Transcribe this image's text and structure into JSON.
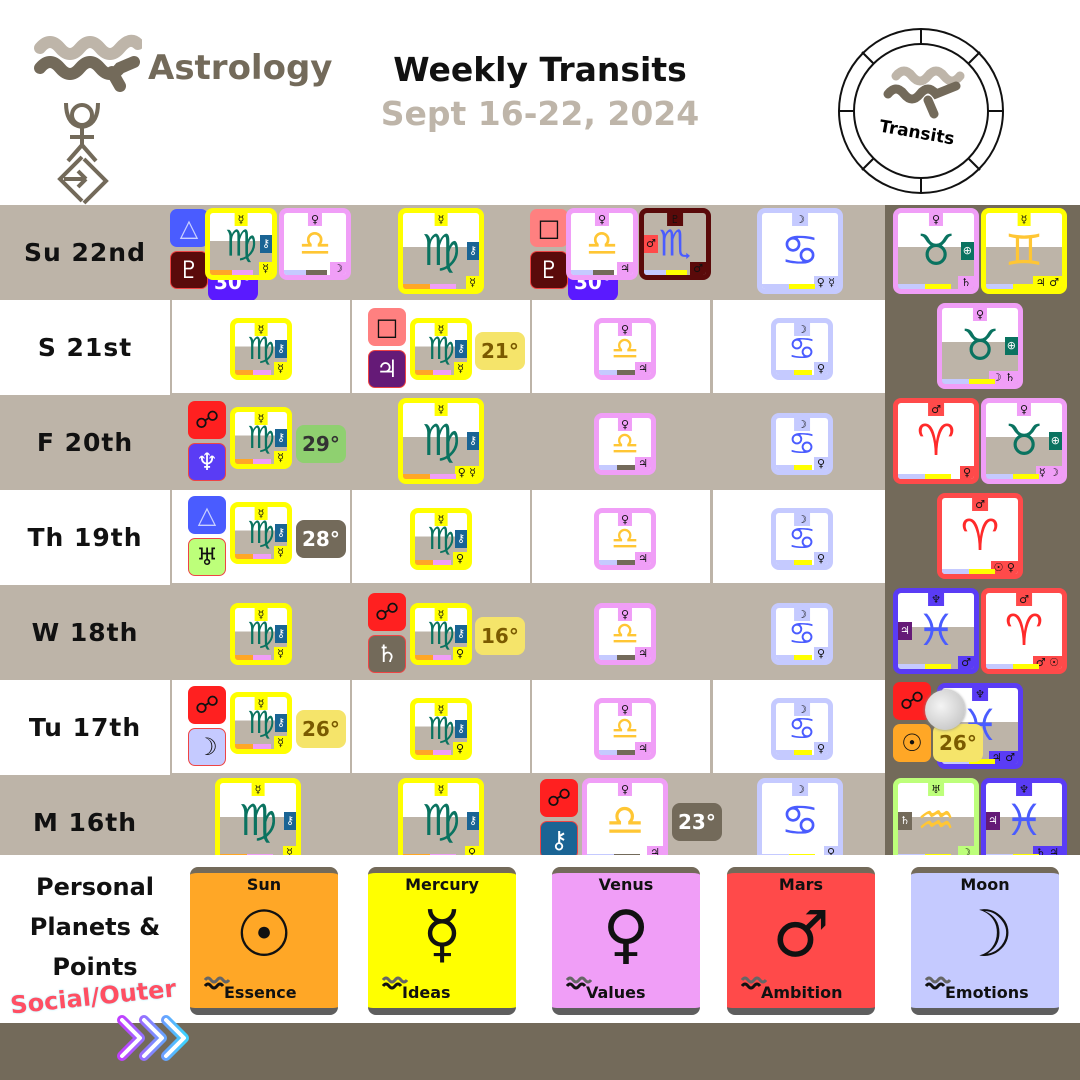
{
  "header": {
    "brand": "Astrology",
    "title": "Weekly Transits",
    "subtitle": "Sept 16-22, 2024",
    "badge_label": "Transits"
  },
  "colors": {
    "brand_dark": "#736a5a",
    "brand_light": "#bdb4a8",
    "sun": "#ffa726",
    "mercury": "#ffff00",
    "venus": "#f09ef7",
    "mars": "#ff4a4a",
    "moon": "#c5caff",
    "jupiter": "#651a77",
    "saturn": "#736a5a",
    "uranus": "#bdff7a",
    "neptune": "#5a3cf5",
    "pluto": "#5a0a0a",
    "chiron": "#1a6494",
    "trine": "#4a5cff",
    "square": "#ff8080",
    "opposition": "#ff2020"
  },
  "days": [
    {
      "label": "Su  22nd",
      "aspect": {
        "type": "trine",
        "glyph": "△",
        "planet": "pluto",
        "planet_glyph": "♇",
        "degree": "30°"
      },
      "aspect2": {
        "type": "square",
        "glyph": "□",
        "planet": "pluto",
        "planet_glyph": "♇",
        "degree": "30°"
      },
      "sun": {
        "sign": "♍",
        "ruler": "☿",
        "co": "☿"
      },
      "mercury_extra": {
        "sign": "♎",
        "ruler": "♀",
        "co": "☽"
      },
      "mercury": {
        "sign": "♍",
        "ruler": "☿",
        "co": "☿"
      },
      "venus": {
        "sign": "♎",
        "ruler": "♀",
        "co": "♃"
      },
      "venus_extra": {
        "sign": "♏",
        "ruler": "♇",
        "co": "♂"
      },
      "mars": {
        "sign": "♋",
        "ruler": "☽",
        "co": "♀ ☿"
      },
      "outer": [
        {
          "sign": "♉",
          "ruler": "♀",
          "co": "♄"
        },
        {
          "sign": "♊",
          "ruler": "☿",
          "co": "♃ ♂"
        }
      ]
    },
    {
      "label": "S   21st",
      "aspect": {
        "type": "square",
        "glyph": "□",
        "planet": "jupiter",
        "planet_glyph": "♃",
        "degree": "21°"
      },
      "sun": {
        "sign": "♍",
        "ruler": "☿",
        "co": "☿"
      },
      "mercury": {
        "sign": "♍",
        "ruler": "☿",
        "co": "☿"
      },
      "venus": {
        "sign": "♎",
        "ruler": "♀",
        "co": "♃"
      },
      "mars": {
        "sign": "♋",
        "ruler": "☽",
        "co": "♀"
      },
      "outer": [
        {
          "sign": "♉",
          "ruler": "♀",
          "co": "☽ ♄"
        }
      ]
    },
    {
      "label": "F   20th",
      "aspect": {
        "type": "opposition",
        "glyph": "☍",
        "planet": "neptune",
        "planet_glyph": "♆",
        "degree": "29°"
      },
      "sun": {
        "sign": "♍",
        "ruler": "☿",
        "co": "☿"
      },
      "mercury": {
        "sign": "♍",
        "ruler": "☿",
        "co": "♀ ☿"
      },
      "venus": {
        "sign": "♎",
        "ruler": "♀",
        "co": "♃"
      },
      "mars": {
        "sign": "♋",
        "ruler": "☽",
        "co": "♀"
      },
      "outer": [
        {
          "sign": "♈",
          "ruler": "♂",
          "co": "♀"
        },
        {
          "sign": "♉",
          "ruler": "♀",
          "co": "☿ ☽"
        }
      ]
    },
    {
      "label": "Th  19th",
      "aspect": {
        "type": "trine",
        "glyph": "△",
        "planet": "uranus",
        "planet_glyph": "♅",
        "degree": "28°"
      },
      "sun": {
        "sign": "♍",
        "ruler": "☿",
        "co": "☿"
      },
      "mercury": {
        "sign": "♍",
        "ruler": "☿",
        "co": "♀"
      },
      "venus": {
        "sign": "♎",
        "ruler": "♀",
        "co": "♃"
      },
      "mars": {
        "sign": "♋",
        "ruler": "☽",
        "co": "♀"
      },
      "outer": [
        {
          "sign": "♈",
          "ruler": "♂",
          "co": "☉ ♀"
        }
      ]
    },
    {
      "label": "W   18th",
      "aspect": {
        "type": "opposition",
        "glyph": "☍",
        "planet": "saturn",
        "planet_glyph": "♄",
        "degree": "16°"
      },
      "sun": {
        "sign": "♍",
        "ruler": "☿",
        "co": "☿"
      },
      "mercury": {
        "sign": "♍",
        "ruler": "☿",
        "co": "♀"
      },
      "venus": {
        "sign": "♎",
        "ruler": "♀",
        "co": "♃"
      },
      "mars": {
        "sign": "♋",
        "ruler": "☽",
        "co": "♀"
      },
      "outer": [
        {
          "sign": "♓",
          "ruler": "♆",
          "co": "♂"
        },
        {
          "sign": "♈",
          "ruler": "♂",
          "co": "♂ ☉"
        }
      ]
    },
    {
      "label": "Tu  17th",
      "aspect": {
        "type": "opposition",
        "glyph": "☍",
        "planet": "moon",
        "planet_glyph": "☽",
        "degree": "26°"
      },
      "sun": {
        "sign": "♍",
        "ruler": "☿",
        "co": "☿"
      },
      "mercury": {
        "sign": "♍",
        "ruler": "☿",
        "co": "♀"
      },
      "venus": {
        "sign": "♎",
        "ruler": "♀",
        "co": "♃"
      },
      "mars": {
        "sign": "♋",
        "ruler": "☽",
        "co": "♀"
      },
      "outer": [
        {
          "sign": "♓",
          "ruler": "♆",
          "co": "♃ ♂",
          "aspect": {
            "type": "opposition",
            "glyph": "☍",
            "planet": "sun",
            "planet_glyph": "☉",
            "degree": "26°",
            "note": "full-moon"
          }
        }
      ]
    },
    {
      "label": "M   16th",
      "aspect": {
        "type": "opposition",
        "glyph": "☍",
        "planet": "chiron",
        "planet_glyph": "⚷",
        "degree": "23°"
      },
      "sun": {
        "sign": "♍",
        "ruler": "☿",
        "co": "☿"
      },
      "mercury": {
        "sign": "♍",
        "ruler": "☿",
        "co": "♀"
      },
      "venus": {
        "sign": "♎",
        "ruler": "♀",
        "co": "♃"
      },
      "mars": {
        "sign": "♋",
        "ruler": "☽",
        "co": "♀"
      },
      "outer": [
        {
          "sign": "♒",
          "ruler": "♅",
          "co": "☽"
        },
        {
          "sign": "♓",
          "ruler": "♆",
          "co": "♄ ♃"
        }
      ]
    }
  ],
  "legend": {
    "title_lines": [
      "Personal",
      "Planets &",
      "Points"
    ],
    "social_label": "Social/Outer",
    "cards": [
      {
        "name": "Sun",
        "glyph": "☉",
        "keyword": "Essence",
        "color": "#ffa726"
      },
      {
        "name": "Mercury",
        "glyph": "☿",
        "keyword": "Ideas",
        "color": "#ffff00"
      },
      {
        "name": "Venus",
        "glyph": "♀",
        "keyword": "Values",
        "color": "#f09ef7"
      },
      {
        "name": "Mars",
        "glyph": "♂",
        "keyword": "Ambition",
        "color": "#ff4a4a"
      },
      {
        "name": "Moon",
        "glyph": "☽",
        "keyword": "Emotions",
        "color": "#c5caff"
      }
    ]
  }
}
